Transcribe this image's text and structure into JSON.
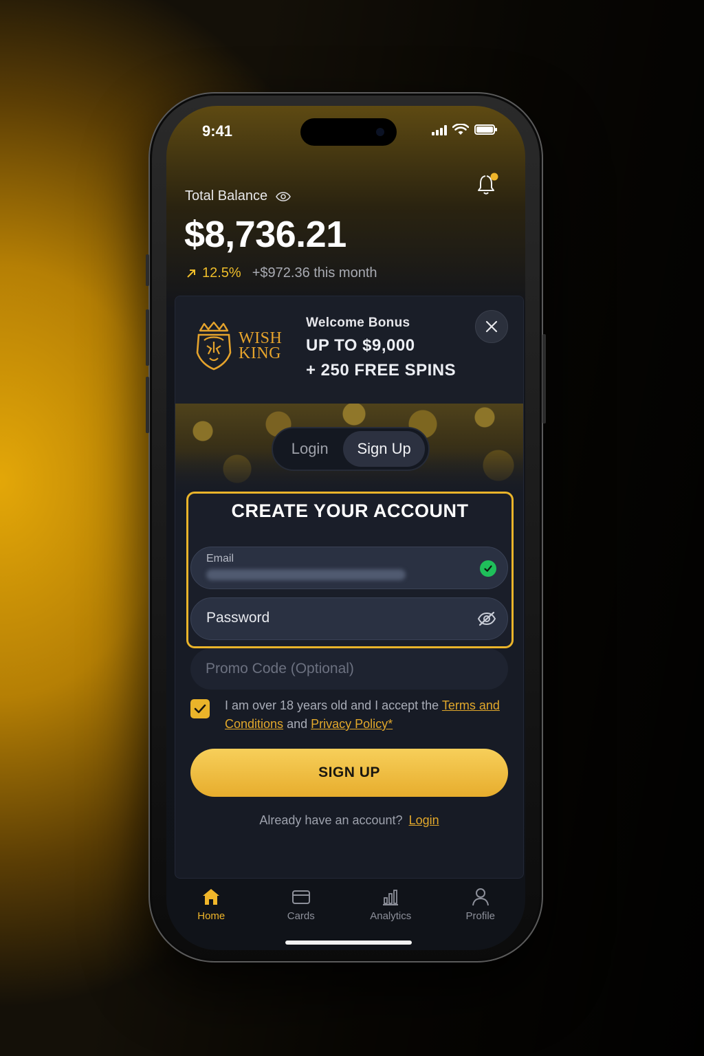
{
  "status_bar": {
    "time": "9:41"
  },
  "balance": {
    "label": "Total Balance",
    "amount": "$8,736.21",
    "change_pct": "12.5%",
    "change_month": "+$972.36 this month"
  },
  "bonus": {
    "logo_line1": "WISH",
    "logo_line2": "KING",
    "title": "Welcome Bonus",
    "line1": "UP TO $9,000",
    "line2": "+ 250 FREE SPINS"
  },
  "tabs": {
    "login": "Login",
    "signup": "Sign Up"
  },
  "form": {
    "title": "CREATE YOUR ACCOUNT",
    "email_label": "Email",
    "password_placeholder": "Password",
    "promo_placeholder": "Promo Code (Optional)",
    "agree_prefix": "I am over 18 years old and I accept the",
    "terms_link": "Terms and Conditions",
    "agree_and": "and",
    "privacy_link": "Privacy Policy*",
    "submit": "SIGN UP",
    "already": "Already have an account?",
    "login_link": "Login"
  },
  "nav": [
    {
      "label": "Home",
      "icon": "home-icon",
      "active": true
    },
    {
      "label": "Cards",
      "icon": "wallet-icon"
    },
    {
      "label": "Analytics",
      "icon": "chart-icon"
    },
    {
      "label": "Profile",
      "icon": "user-icon"
    }
  ],
  "colors": {
    "accent": "#EAB42A",
    "success": "#1FBF5A",
    "background": "#101319"
  }
}
